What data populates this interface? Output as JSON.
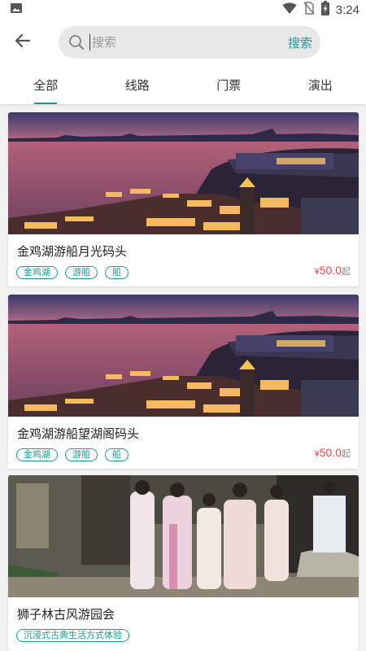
{
  "status_bar": {
    "time": "3:24",
    "icons": [
      "image-icon",
      "wifi-icon",
      "no-sim-icon",
      "battery-charging-icon"
    ]
  },
  "header": {
    "back_icon": "arrow-left-icon",
    "search": {
      "placeholder": "搜索",
      "button_label": "搜索",
      "icon": "search-icon"
    }
  },
  "tabs": [
    {
      "label": "全部",
      "active": true
    },
    {
      "label": "线路",
      "active": false
    },
    {
      "label": "门票",
      "active": false
    },
    {
      "label": "演出",
      "active": false
    }
  ],
  "colors": {
    "accent": "#1a9a96",
    "price": "#e64545",
    "background": "#f2f2f2"
  },
  "cards": [
    {
      "title": "金鸡湖游船月光码头",
      "tags": [
        "金鸡湖",
        "游船",
        "船"
      ],
      "price": {
        "currency": "¥",
        "amount": "50.0",
        "suffix": "起"
      },
      "image": "lakeside-dusk-scene"
    },
    {
      "title": "金鸡湖游船望湖阁码头",
      "tags": [
        "金鸡湖",
        "游船",
        "船"
      ],
      "price": {
        "currency": "¥",
        "amount": "50.0",
        "suffix": "起"
      },
      "image": "lakeside-dusk-scene"
    },
    {
      "title": "狮子林古风游园会",
      "tags": [
        "沉浸式古典生活方式体验"
      ],
      "image": "hanfu-garden-scene"
    }
  ]
}
